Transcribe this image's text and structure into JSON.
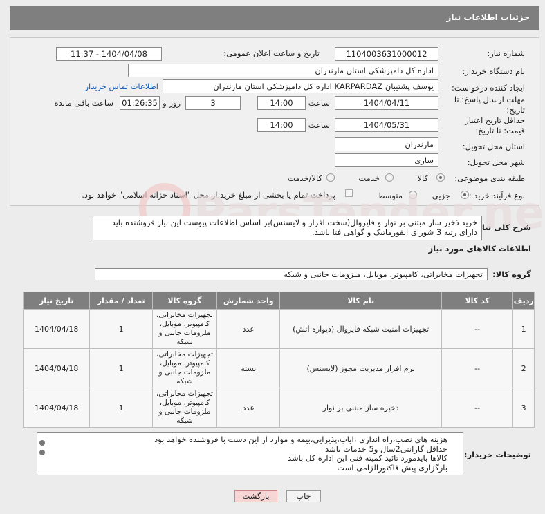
{
  "header": {
    "title": "جزئیات اطلاعات نیاز"
  },
  "form": {
    "need_number_label": "شماره نیاز:",
    "need_number": "1104003631000012",
    "announce_label": "تاریخ و ساعت اعلان عمومی:",
    "announce_value": "1404/04/08 - 11:37",
    "buyer_org_label": "نام دستگاه خریدار:",
    "buyer_org": "اداره کل دامپزشکی استان مازندران",
    "creator_label": "ایجاد کننده درخواست:",
    "creator": "یوسف پشتیبان KARPARDAZ اداره کل دامپزشکی استان مازندران",
    "contact_link": "اطلاعات تماس خریدار",
    "reply_deadline_label": "مهلت ارسال پاسخ: تا تاریخ:",
    "reply_date": "1404/04/11",
    "time_label": "ساعت",
    "reply_time": "14:00",
    "days_value": "3",
    "days_label": "روز و",
    "remaining_time": "01:26:35",
    "remaining_label": "ساعت باقی مانده",
    "price_validity_label": "حداقل تاریخ اعتبار قیمت: تا تاریخ:",
    "price_date": "1404/05/31",
    "price_time": "14:00",
    "province_label": "استان محل تحویل:",
    "province": "مازندران",
    "city_label": "شهر محل تحویل:",
    "city": "ساری",
    "category_label": "طبقه بندی موضوعی:",
    "category_options": [
      "کالا",
      "خدمت",
      "کالا/خدمت"
    ],
    "process_label": "نوع فرآیند خرید :",
    "process_options": [
      "جزیی",
      "متوسط"
    ],
    "payment_note": "پرداخت تمام یا بخشی از مبلغ خرید،از محل \"اسناد خزانه اسلامی\" خواهد بود."
  },
  "description": {
    "label": "شرح کلی نیاز:",
    "text": "خرید ذخیر ساز مبتنی بر نوار و فایروال(سخت افزار و لایسنس)بر اساس اطلاعات پیوست این نیاز فروشنده باید دارای رتبه 3 شورای انفورماتیک و گواهی فتا باشد."
  },
  "goods": {
    "section_title": "اطلاعات کالاهای مورد نیاز",
    "group_label": "گروه کالا:",
    "group_value": "تجهیزات مخابراتی، کامپیوتر، موبایل، ملزومات جانبی و شبکه",
    "columns": [
      "ردیف",
      "کد کالا",
      "نام کالا",
      "واحد شمارش",
      "گروه کالا",
      "تعداد / مقدار",
      "تاریخ نیاز"
    ],
    "rows": [
      {
        "row": "1",
        "code": "--",
        "name": "تجهیزات امنیت شبکه فایروال (دیواره آتش)",
        "unit": "عدد",
        "group": "تجهیزات مخابراتی، کامپیوتر، موبایل، ملزومات جانبی و شبکه",
        "qty": "1",
        "date": "1404/04/18"
      },
      {
        "row": "2",
        "code": "--",
        "name": "نرم افزار مدیریت مجوز (لایسنس)",
        "unit": "بسته",
        "group": "تجهیزات مخابراتی، کامپیوتر، موبایل، ملزومات جانبی و شبکه",
        "qty": "1",
        "date": "1404/04/18"
      },
      {
        "row": "3",
        "code": "--",
        "name": "ذخیره ساز مبتنی بر نوار",
        "unit": "عدد",
        "group": "تجهیزات مخابراتی، کامپیوتر، موبایل، ملزومات جانبی و شبکه",
        "qty": "1",
        "date": "1404/04/18"
      }
    ]
  },
  "notes": {
    "label": "توضیحات خریدار:",
    "lines": [
      "هزینه های نصب،راه اندازی ،ایاب،پذیرایی،بیمه و موارد از این دست با فروشنده خواهد بود",
      "حداقل گارانتی2سال و5 خدمات باشد",
      "کالاها بایدمورد تائید کمیته فنی این اداره کل باشد",
      "بارگزاری پیش فاکتورالزامی است"
    ]
  },
  "buttons": {
    "print": "چاپ",
    "back": "بازگشت"
  }
}
